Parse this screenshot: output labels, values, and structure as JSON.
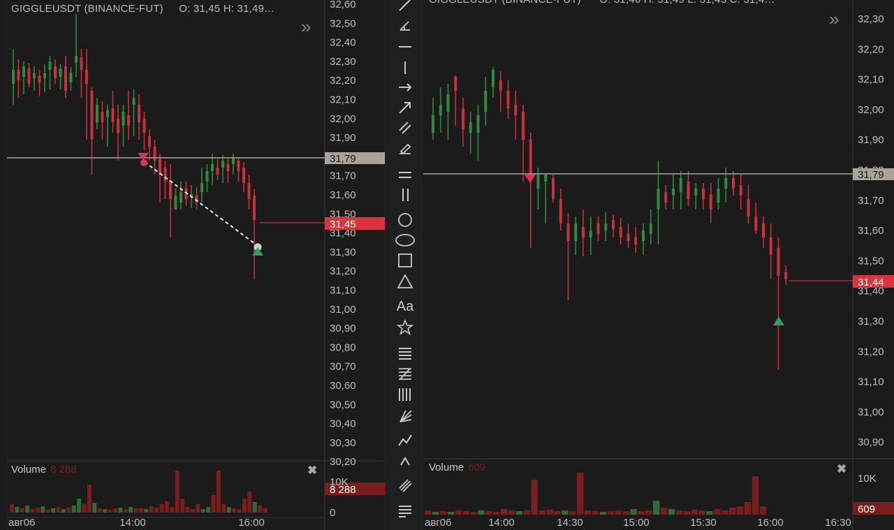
{
  "left": {
    "title": "GIGGLEUSDT (BINANCE-FUT)",
    "ohlc": "O: 31,45  H: 31,49…",
    "price_ticks": [
      "32,60",
      "32,50",
      "32,40",
      "32,30",
      "32,20",
      "32,10",
      "32,00",
      "31,90",
      "31,80",
      "31,70",
      "31,60",
      "31,50",
      "31,40",
      "31,30",
      "31,20",
      "31,10",
      "31,00",
      "30,90",
      "30,80",
      "30,70",
      "30,60",
      "30,50",
      "30,40",
      "30,30",
      "30,20"
    ],
    "level_label": "31,79",
    "last_price_label": "31,45",
    "volume_title": "Volume",
    "volume_value": "8 288",
    "volume_axis_top": "10K",
    "volume_axis_zero": "0",
    "volume_last_label": "8 288",
    "time_ticks": [
      "авг06",
      "14:00",
      "16:00"
    ]
  },
  "right": {
    "title": "GIGGLEUSDT (BINANCE-FUT)",
    "ohlc": "O: 31,46  H: 31,49  L: 31,43  C: 31,4…",
    "price_ticks": [
      "32,30",
      "32,20",
      "32,10",
      "32,00",
      "31,90",
      "31,80",
      "31,70",
      "31,60",
      "31,50",
      "31,40",
      "31,30",
      "31,20",
      "31,10",
      "31,00",
      "30,90"
    ],
    "level_label": "31,79",
    "last_price_label": "31,44",
    "volume_title": "Volume",
    "volume_value": "609",
    "volume_axis_top": "10K",
    "volume_last_label": "609",
    "time_ticks": [
      "авг06",
      "14:00",
      "14:30",
      "15:00",
      "15:30",
      "16:00",
      "16:30"
    ]
  },
  "toolbar": {
    "tools": [
      "trend-line",
      "angle-line",
      "horizontal-line",
      "vertical-line",
      "ray",
      "arrow",
      "parallel-channel",
      "brush",
      "horizontal-pair",
      "vertical-pair",
      "circle",
      "ellipse",
      "rectangle",
      "triangle",
      "text",
      "star",
      "fib-levels",
      "fib-retracement",
      "fib-time",
      "gann-fan",
      "polyline",
      "path",
      "pitchfork",
      "notes"
    ],
    "text_tool_label": "Aa"
  },
  "colors": {
    "background": "#1b1b1b",
    "up": "#2e8b3e",
    "down": "#c8313b",
    "level_line": "#a9a39a",
    "last_price_bg": "#d9343b",
    "volume_bg": "#7a1d1d",
    "sell_marker": "#e0315a",
    "buy_marker": "#2f9d5a"
  }
}
